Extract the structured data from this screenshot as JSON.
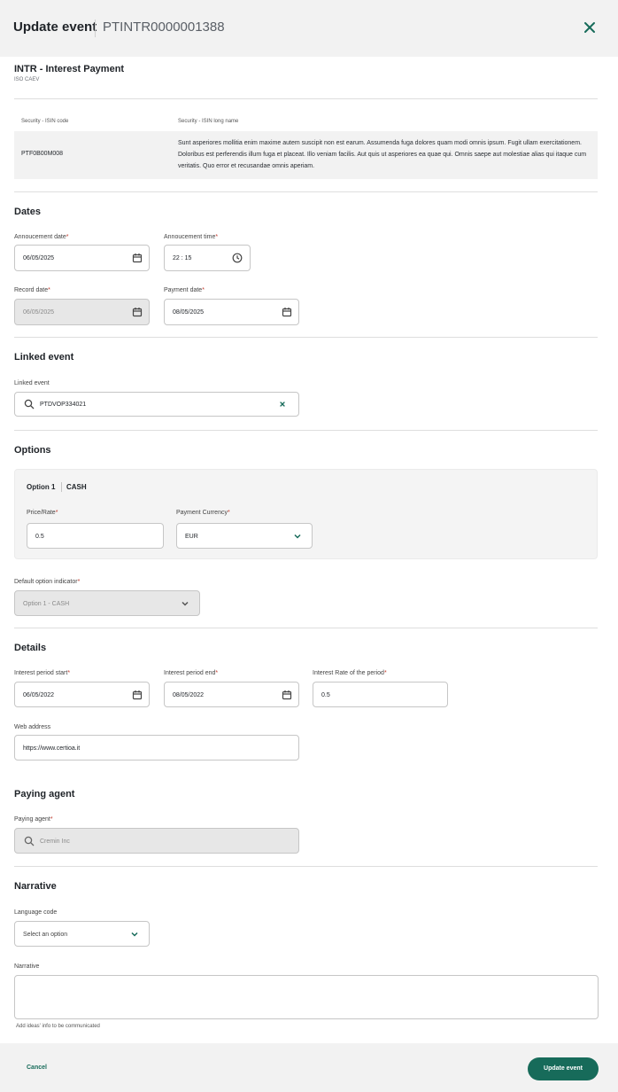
{
  "header": {
    "title": "Update event",
    "event_id": "PTINTR0000001388"
  },
  "event": {
    "name": "INTR - Interest Payment",
    "code": "ISO CAEV"
  },
  "securities_table": {
    "headers": [
      "Security - ISIN code",
      "Security - ISIN long name"
    ],
    "rows": [
      {
        "isin": "PTF0B00M008",
        "long_name": "Sunt asperiores mollitia enim maxime autem suscipit non est earum. Assumenda fuga dolores quam modi omnis ipsum. Fugit ullam exercitationem. Doloribus est perferendis illum fuga et placeat. Illo veniam facilis. Aut quis ut asperiores ea quae qui. Omnis saepe aut molestiae alias qui itaque cum veritatis. Quo error et recusandae omnis aperiam."
      }
    ]
  },
  "dates": {
    "title": "Dates",
    "announcement_date_label": "Annoucement date",
    "announcement_date": "06/05/2025",
    "announcement_time_label": "Annoucement time",
    "announcement_time": "22 : 15",
    "record_date_label": "Record date",
    "record_date": "06/05/2025",
    "payment_date_label": "Payment date",
    "payment_date": "08/05/2025"
  },
  "linked": {
    "title": "Linked event",
    "label": "Linked event",
    "value": "PTDVOP334021"
  },
  "options": {
    "title": "Options",
    "option_name": "Option 1",
    "option_type": "CASH",
    "price_label": "Price/Rate",
    "price": "0.5",
    "currency_label": "Payment Currency",
    "currency": "EUR",
    "default_label": "Default option indicator",
    "default_value": "Option 1 - CASH"
  },
  "details": {
    "title": "Details",
    "start_label": "Interest period start",
    "start": "06/05/2022",
    "end_label": "Interest period end",
    "end": "08/05/2022",
    "rate_label": "Interest Rate of the period",
    "rate": "0.5",
    "web_label": "Web address",
    "web": "https://www.certioa.it"
  },
  "paying_agent": {
    "title": "Paying agent",
    "label": "Paying agent",
    "value": "Cremin Inc"
  },
  "narrative": {
    "title": "Narrative",
    "language_label": "Language code",
    "language_placeholder": "Select an option",
    "narrative_label": "Narrative",
    "hint": "Add ideas' info to be communicated"
  },
  "footer": {
    "cancel": "Cancel",
    "submit": "Update event"
  },
  "colors": {
    "accent": "#176b5a",
    "required": "#c0392b",
    "header_bg": "#f2f2f2"
  },
  "icons": [
    "close-icon",
    "calendar-icon",
    "clock-icon",
    "search-icon",
    "clear-icon",
    "chevron-down-icon"
  ]
}
